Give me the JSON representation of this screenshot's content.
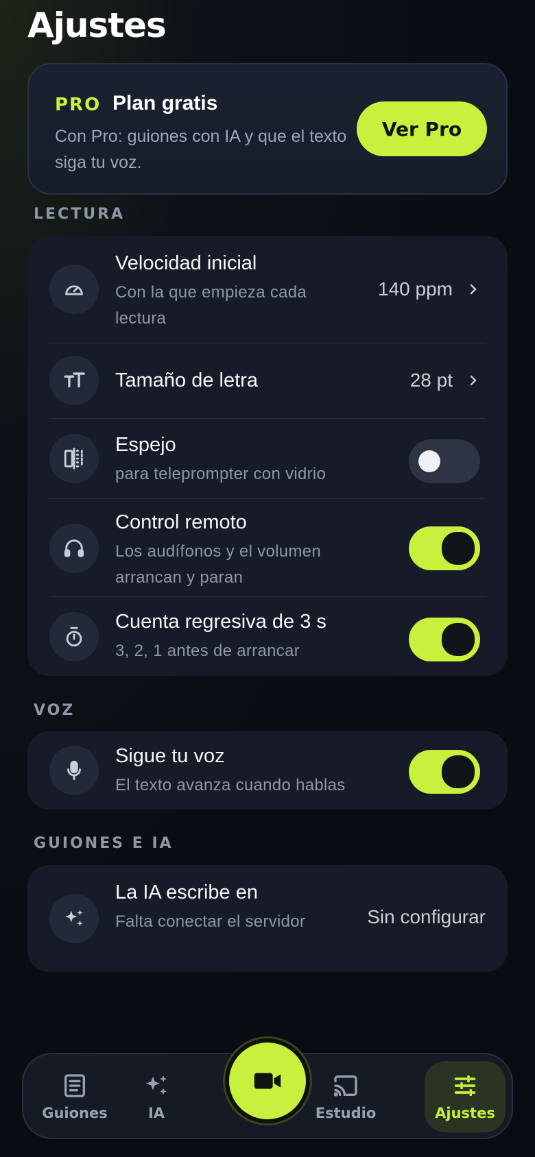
{
  "page": {
    "title": "Ajustes"
  },
  "pro": {
    "badge": "PRO",
    "title": "Plan gratis",
    "description": "Con Pro: guiones con IA y que el texto siga tu voz.",
    "button": "Ver Pro"
  },
  "sections": {
    "lectura": {
      "label": "LECTURA",
      "speed": {
        "title": "Velocidad inicial",
        "subtitle": "Con la que empieza cada lectura",
        "value": "140 ppm",
        "icon": "gauge-icon"
      },
      "font_size": {
        "title": "Tamaño de letra",
        "value": "28 pt",
        "icon": "text-size-icon"
      },
      "mirror": {
        "title": "Espejo",
        "subtitle": "para teleprompter con vidrio",
        "enabled": false,
        "icon": "mirror-icon"
      },
      "remote": {
        "title": "Control remoto",
        "subtitle": "Los audífonos y el volumen arrancan y paran",
        "enabled": true,
        "icon": "headphones-icon"
      },
      "countdown": {
        "title": "Cuenta regresiva de 3 s",
        "subtitle": "3, 2, 1 antes de arrancar",
        "enabled": true,
        "icon": "timer-icon"
      }
    },
    "voz": {
      "label": "VOZ",
      "follow_voice": {
        "title": "Sigue tu voz",
        "subtitle": "El texto avanza cuando hablas",
        "enabled": true,
        "icon": "microphone-icon"
      }
    },
    "guiones": {
      "label": "GUIONES E IA",
      "ai_writes": {
        "title": "La IA escribe en",
        "subtitle": "Falta conectar el servidor",
        "value": "Sin configurar",
        "icon": "sparkles-icon"
      }
    }
  },
  "nav": {
    "items": [
      {
        "label": "Guiones",
        "icon": "document-icon",
        "active": false
      },
      {
        "label": "IA",
        "icon": "sparkles-icon",
        "active": false
      },
      {
        "label": "",
        "icon": "video-camera-icon",
        "active": false
      },
      {
        "label": "Estudio",
        "icon": "cast-icon",
        "active": false
      },
      {
        "label": "Ajustes",
        "icon": "sliders-icon",
        "active": true
      }
    ]
  },
  "colors": {
    "accent": "#c8f03c",
    "background": "#0a0d14",
    "card": "#161b27",
    "muted": "#8e96a5"
  }
}
